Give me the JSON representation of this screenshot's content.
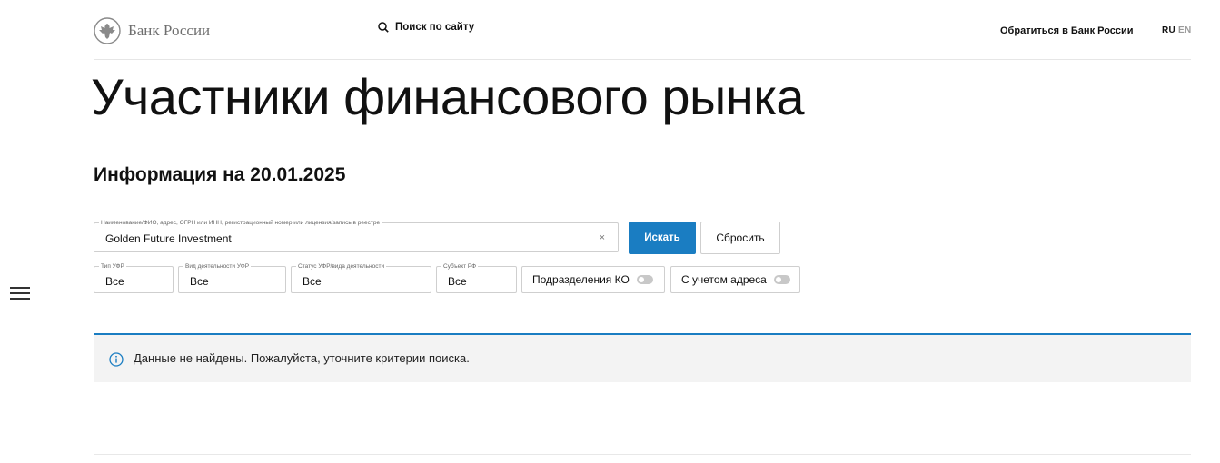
{
  "header": {
    "logo_text": "Банк России",
    "search_label": "Поиск по сайту",
    "contact_link": "Обратиться в Банк России",
    "lang_ru": "RU",
    "lang_en": "EN"
  },
  "page": {
    "title": "Участники финансового рынка",
    "subtitle": "Информация на 20.01.2025"
  },
  "search_form": {
    "main_field": {
      "legend": "Наименование/ФИО, адрес, ОГРН или ИНН, регистрационный номер или лицензия/запись в реестре",
      "value": "Golden Future Investment",
      "clear_symbol": "×"
    },
    "search_button": "Искать",
    "reset_button": "Сбросить",
    "filters": [
      {
        "legend": "Тип УФР",
        "value": "Все"
      },
      {
        "legend": "Вид деятельности УФР",
        "value": "Все"
      },
      {
        "legend": "Статус УФР/вида деятельности",
        "value": "Все"
      },
      {
        "legend": "Субъект РФ",
        "value": "Все"
      }
    ],
    "toggles": [
      {
        "label": "Подразделения КО",
        "on": false
      },
      {
        "label": "С учетом адреса",
        "on": false
      }
    ]
  },
  "alert": {
    "text": "Данные не найдены. Пожалуйста, уточните критерии поиска.",
    "icon": "info-icon"
  },
  "colors": {
    "accent": "#1a7dc2",
    "alert_bg": "#f3f3f3"
  }
}
